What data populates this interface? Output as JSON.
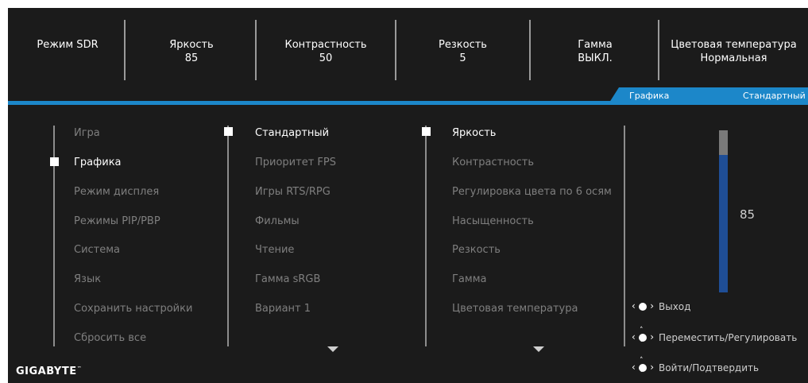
{
  "status_bar": [
    {
      "label": "Режим SDR",
      "value": ""
    },
    {
      "label": "Яркость",
      "value": "85"
    },
    {
      "label": "Контрастность",
      "value": "50"
    },
    {
      "label": "Резкость",
      "value": "5"
    },
    {
      "label": "Гамма",
      "value": "ВЫКЛ."
    },
    {
      "label": "Цветовая температура",
      "value": "Нормальная"
    }
  ],
  "breadcrumb": {
    "section": "Графика",
    "mode": "Стандартный"
  },
  "main_menu": [
    "Игра",
    "Графика",
    "Режим дисплея",
    "Режимы PIP/PBP",
    "Система",
    "Язык",
    "Сохранить настройки",
    "Сбросить все"
  ],
  "main_menu_selected": 1,
  "picture_modes": [
    "Стандартный",
    "Приоритет FPS",
    "Игры RTS/RPG",
    "Фильмы",
    "Чтение",
    "Гамма sRGB",
    "Вариант 1"
  ],
  "picture_modes_selected": 0,
  "settings": [
    "Яркость",
    "Контрастность",
    "Регулировка цвета по 6 осям",
    "Насыщенность",
    "Резкость",
    "Гамма",
    "Цветовая температура"
  ],
  "settings_selected": 0,
  "slider": {
    "value": "85",
    "fraction": 0.85
  },
  "help": [
    {
      "icon": "joystick-left-right-icon",
      "label": "Выход"
    },
    {
      "icon": "joystick-four-way-icon",
      "label": "Переместить/Регулировать"
    },
    {
      "icon": "joystick-press-icon",
      "label": "Войти/Подтвердить"
    }
  ],
  "brand": {
    "name": "GIGABYTE",
    "trademark": "™"
  },
  "colors": {
    "accent": "#1c87c9",
    "slider_fill": "#1f4e96",
    "background": "#1b1b1b"
  }
}
